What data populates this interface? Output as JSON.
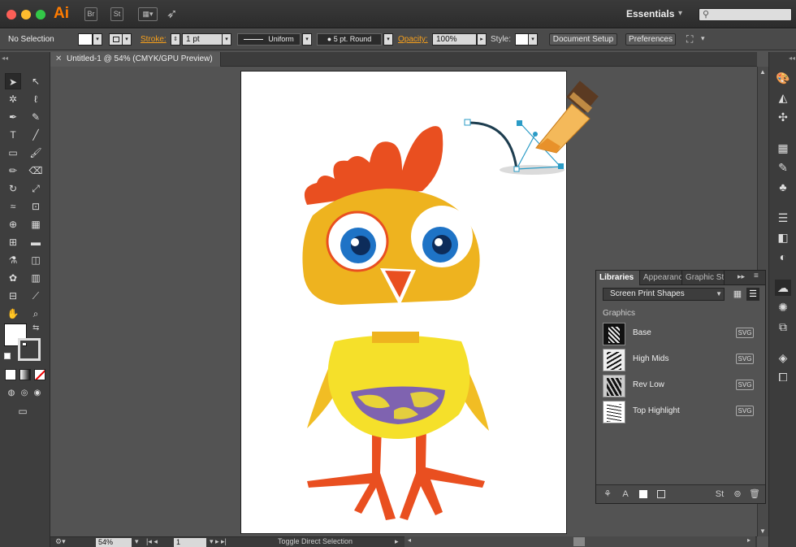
{
  "app": {
    "logo": "Ai",
    "bridge_label": "Br",
    "stock_label": "St",
    "workspace": "Essentials",
    "search_placeholder": ""
  },
  "control_bar": {
    "selection_state": "No Selection",
    "stroke_label": "Stroke:",
    "stroke_weight": "1 pt",
    "stroke_profile": "Uniform",
    "brush": "5 pt. Round",
    "opacity_label": "Opacity:",
    "opacity_value": "100%",
    "style_label": "Style:",
    "document_setup_label": "Document Setup",
    "preferences_label": "Preferences"
  },
  "document": {
    "tab_title": "Untitled-1 @ 54% (CMYK/GPU Preview)"
  },
  "libraries_panel": {
    "tabs": [
      {
        "label": "Libraries",
        "active": true
      },
      {
        "label": "Appearance",
        "active": false
      },
      {
        "label": "Graphic Styles",
        "active": false
      }
    ],
    "selected_library": "Screen Print Shapes",
    "section_title": "Graphics",
    "items": [
      {
        "name": "Base",
        "badge": "SVG"
      },
      {
        "name": "High Mids",
        "badge": "SVG"
      },
      {
        "name": "Rev Low",
        "badge": "SVG"
      },
      {
        "name": "Top Highlight",
        "badge": "SVG"
      }
    ]
  },
  "status_bar": {
    "zoom": "54%",
    "artboard_number": "1",
    "status_text": "Toggle Direct Selection"
  },
  "colors": {
    "accent_orange": "#f7a01c",
    "chick_head": "#eeb31f",
    "chick_body": "#f5e02a",
    "crest": "#e94f20",
    "eye_blue": "#1e73c6",
    "belly_purple": "#7f63b0"
  }
}
